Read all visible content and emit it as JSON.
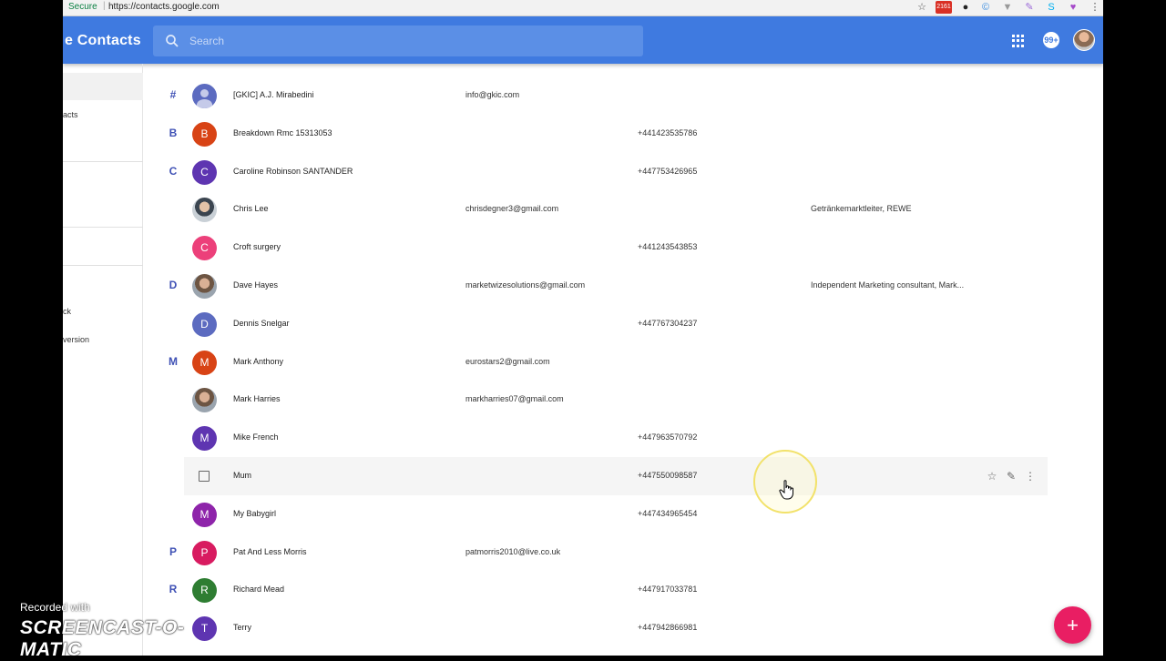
{
  "browser": {
    "secure_label": "Secure",
    "url": "https://contacts.google.com",
    "gmail_badge": "2161"
  },
  "app": {
    "title": "e Contacts",
    "search_placeholder": "Search",
    "notifications": "99+"
  },
  "sidebar": {
    "items": [
      "acts",
      "ck",
      "version"
    ]
  },
  "contacts": [
    {
      "letter": "#",
      "name": "[GKIC] A.J. Mirabedini",
      "email": "info@gkic.com",
      "phone": "",
      "job": "",
      "avatar": "generic",
      "initial": "",
      "color": "#5c6bc0"
    },
    {
      "letter": "B",
      "name": "Breakdown Rmc 15313053",
      "email": "",
      "phone": "+441423535786",
      "job": "",
      "avatar": "initial",
      "initial": "B",
      "color": "#d84315"
    },
    {
      "letter": "C",
      "name": "Caroline Robinson SANTANDER",
      "email": "",
      "phone": "+447753426965",
      "job": "",
      "avatar": "initial",
      "initial": "C",
      "color": "#5e35b1"
    },
    {
      "letter": "",
      "name": "Chris Lee",
      "email": "chrisdegner3@gmail.com",
      "phone": "",
      "job": "Getränkemarktleiter, REWE",
      "avatar": "photo2",
      "initial": "",
      "color": ""
    },
    {
      "letter": "",
      "name": "Croft surgery",
      "email": "",
      "phone": "+441243543853",
      "job": "",
      "avatar": "initial",
      "initial": "C",
      "color": "#ec407a"
    },
    {
      "letter": "D",
      "name": "Dave Hayes",
      "email": "marketwizesolutions@gmail.com",
      "phone": "",
      "job": "Independent Marketing consultant, Mark...",
      "avatar": "photo",
      "initial": "",
      "color": ""
    },
    {
      "letter": "",
      "name": "Dennis Snelgar",
      "email": "",
      "phone": "+447767304237",
      "job": "",
      "avatar": "initial",
      "initial": "D",
      "color": "#5c6bc0"
    },
    {
      "letter": "M",
      "name": "Mark Anthony",
      "email": "eurostars2@gmail.com",
      "phone": "",
      "job": "",
      "avatar": "initial",
      "initial": "M",
      "color": "#d84315"
    },
    {
      "letter": "",
      "name": "Mark Harries",
      "email": "markharries07@gmail.com",
      "phone": "",
      "job": "",
      "avatar": "photo",
      "initial": "",
      "color": ""
    },
    {
      "letter": "",
      "name": "Mike French",
      "email": "",
      "phone": "+447963570792",
      "job": "",
      "avatar": "initial",
      "initial": "M",
      "color": "#5e35b1"
    },
    {
      "letter": "",
      "name": "Mum",
      "email": "",
      "phone": "+447550098587",
      "job": "",
      "avatar": "checkbox",
      "initial": "",
      "color": "",
      "hover": true
    },
    {
      "letter": "",
      "name": "My Babygirl",
      "email": "",
      "phone": "+447434965454",
      "job": "",
      "avatar": "initial",
      "initial": "M",
      "color": "#8e24aa"
    },
    {
      "letter": "P",
      "name": "Pat And Less Morris",
      "email": "patmorris2010@live.co.uk",
      "phone": "",
      "job": "",
      "avatar": "initial",
      "initial": "P",
      "color": "#d81b60"
    },
    {
      "letter": "R",
      "name": "Richard Mead",
      "email": "",
      "phone": "+447917033781",
      "job": "",
      "avatar": "initial",
      "initial": "R",
      "color": "#2e7d32"
    },
    {
      "letter": "",
      "name": "Terry",
      "email": "",
      "phone": "+447942866981",
      "job": "",
      "avatar": "initial",
      "initial": "T",
      "color": "#5e35b1"
    }
  ],
  "row_actions": {
    "star_icon": "star-icon",
    "edit_icon": "pencil-icon",
    "more_icon": "more-vert-icon"
  },
  "fab_label": "+",
  "watermark": {
    "small": "Recorded with",
    "big": "SCREENCAST-O-MATIC"
  },
  "colors": {
    "appbar": "#3f7ae0",
    "letter": "#3f51b5",
    "fab": "#e91e63"
  }
}
